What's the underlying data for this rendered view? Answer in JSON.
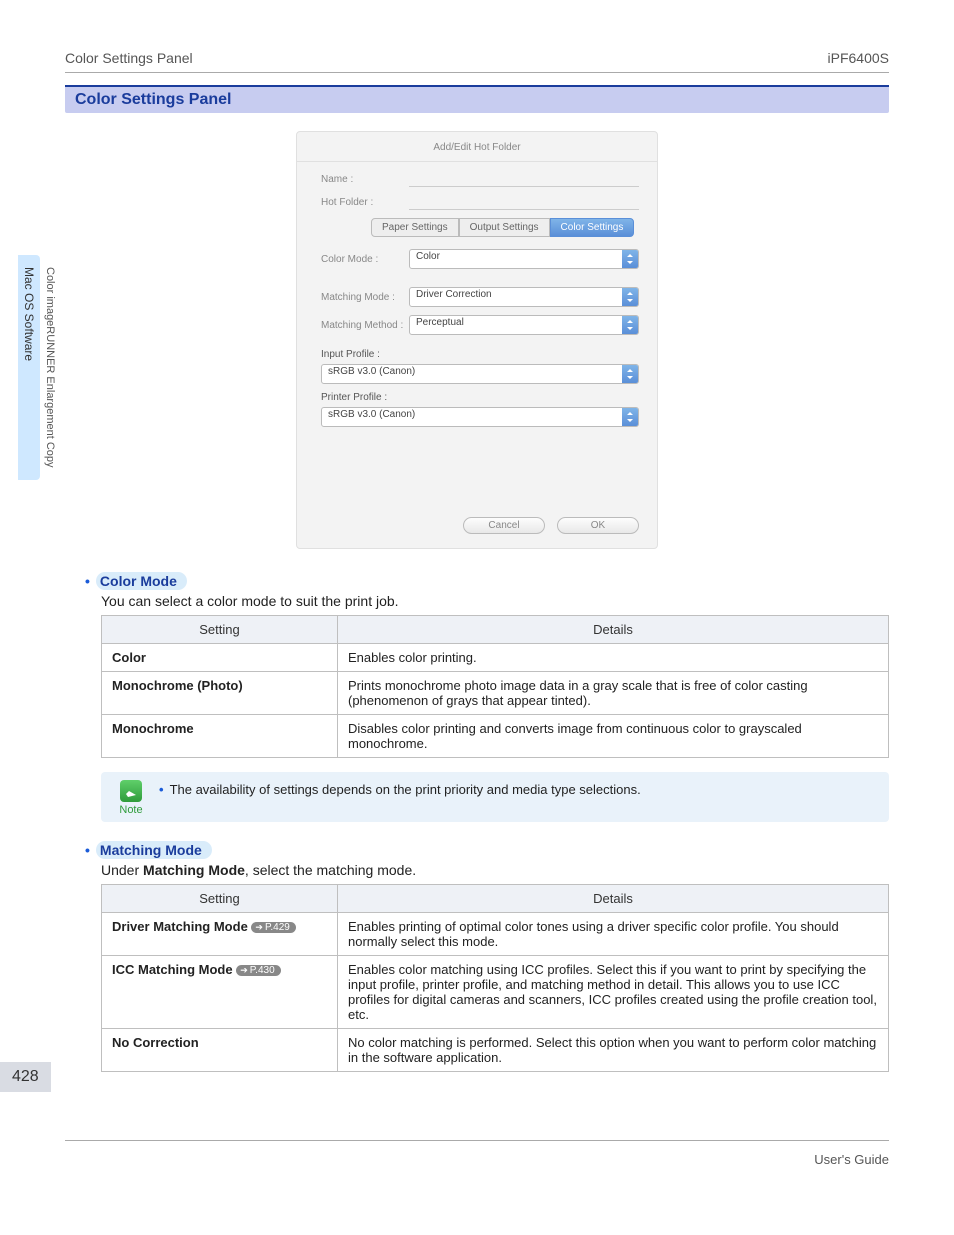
{
  "header": {
    "left": "Color Settings Panel",
    "right": "iPF6400S"
  },
  "title": "Color Settings Panel",
  "side_tabs": {
    "primary": "Mac OS Software",
    "secondary": "Color imageRUNNER Enlargement Copy"
  },
  "dialog": {
    "title": "Add/Edit Hot Folder",
    "name_label": "Name :",
    "hotfolder_label": "Hot Folder :",
    "tabs": [
      "Paper Settings",
      "Output Settings",
      "Color Settings"
    ],
    "fields": {
      "color_mode": {
        "label": "Color Mode :",
        "value": "Color"
      },
      "matching_mode": {
        "label": "Matching Mode :",
        "value": "Driver Correction"
      },
      "matching_method": {
        "label": "Matching Method :",
        "value": "Perceptual"
      },
      "input_profile": {
        "label": "Input Profile :",
        "value": "sRGB v3.0 (Canon)"
      },
      "printer_profile": {
        "label": "Printer Profile :",
        "value": "sRGB v3.0 (Canon)"
      }
    },
    "buttons": {
      "cancel": "Cancel",
      "ok": "OK"
    }
  },
  "color_mode": {
    "heading": "Color Mode",
    "desc": "You can select a color mode to suit the print job.",
    "cols": [
      "Setting",
      "Details"
    ],
    "rows": [
      {
        "setting": "Color",
        "details": "Enables color printing."
      },
      {
        "setting": "Monochrome (Photo)",
        "details": "Prints monochrome photo image data in a gray scale that is free of color casting (phenomenon of grays that appear tinted)."
      },
      {
        "setting": "Monochrome",
        "details": "Disables color printing and converts image from continuous color to grayscaled monochrome."
      }
    ]
  },
  "note": {
    "label": "Note",
    "text": "The availability of settings depends on the print priority and media type selections."
  },
  "matching_mode": {
    "heading": "Matching Mode",
    "desc_prefix": "Under ",
    "desc_bold": "Matching Mode",
    "desc_suffix": ", select the matching mode.",
    "cols": [
      "Setting",
      "Details"
    ],
    "rows": [
      {
        "setting": "Driver Matching Mode",
        "pref": "P.429",
        "details": "Enables printing of optimal color tones using a driver specific color profile. You should normally select this mode."
      },
      {
        "setting": "ICC Matching Mode",
        "pref": "P.430",
        "details": "Enables color matching using ICC profiles. Select this if you want to print by specifying the input profile, printer profile, and matching method in detail. This allows you to use ICC profiles for digital cameras and scanners, ICC profiles created using the profile creation tool, etc."
      },
      {
        "setting": "No Correction",
        "details": "No color matching is performed. Select this option when you want to perform color matching in the software application."
      }
    ]
  },
  "footer": {
    "page_num": "428",
    "guide": "User's Guide"
  }
}
